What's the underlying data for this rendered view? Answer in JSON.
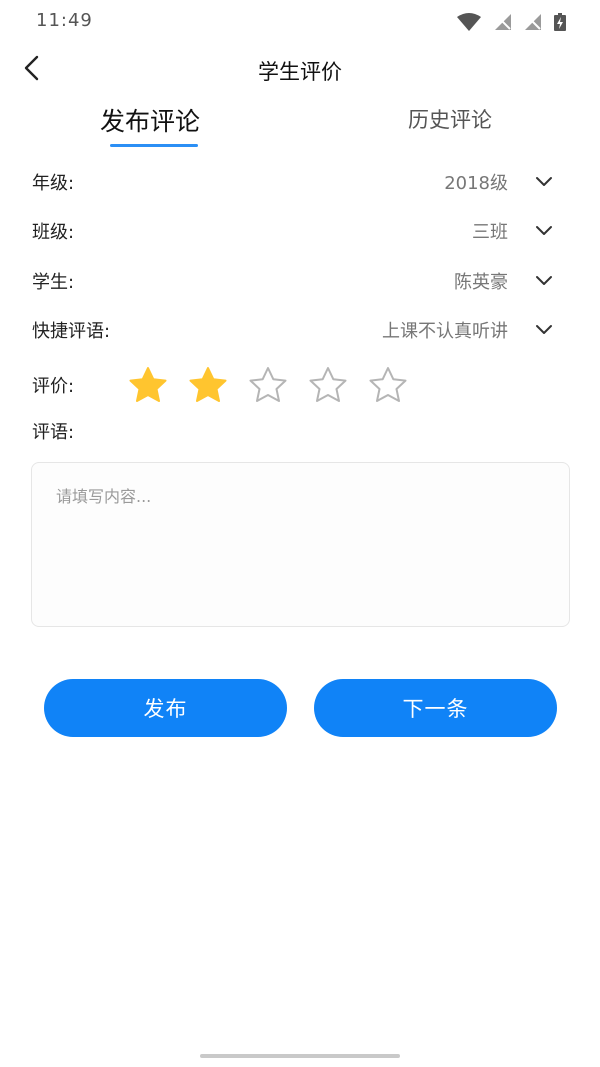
{
  "status_bar": {
    "time": "11:49",
    "icons": [
      "wifi-icon",
      "signal-off-icon",
      "signal-off-icon",
      "battery-charging-icon"
    ]
  },
  "nav": {
    "back_icon": "chevron-left-icon",
    "title": "学生评价"
  },
  "tabs": [
    {
      "label": "发布评论",
      "active": true
    },
    {
      "label": "历史评论",
      "active": false
    }
  ],
  "form": {
    "grade": {
      "label": "年级:",
      "value": "2018级"
    },
    "class": {
      "label": "班级:",
      "value": "三班"
    },
    "student": {
      "label": "学生:",
      "value": "陈英豪"
    },
    "quick_comment": {
      "label": "快捷评语:",
      "value": "上课不认真听讲"
    },
    "rating": {
      "label": "评价:",
      "value": 2,
      "max": 5
    },
    "comment": {
      "label": "评语:",
      "placeholder": "请填写内容...",
      "value": ""
    }
  },
  "buttons": {
    "publish": "发布",
    "next": "下一条"
  },
  "colors": {
    "accent": "#1083f7",
    "star_filled": "#ffc52f",
    "star_empty": "#b5b5b5"
  }
}
